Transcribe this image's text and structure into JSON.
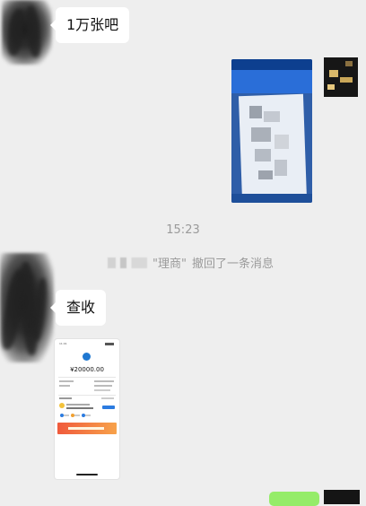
{
  "messages": {
    "msg1_text": "1万张吧",
    "msg2_text": "查收"
  },
  "time_divider": "15:23",
  "recall_notice": {
    "name_suffix": "\"理商\"",
    "text": "撤回了一条消息"
  },
  "receipt_image": {
    "status_time": "11:01",
    "amount": "¥20000.00"
  }
}
